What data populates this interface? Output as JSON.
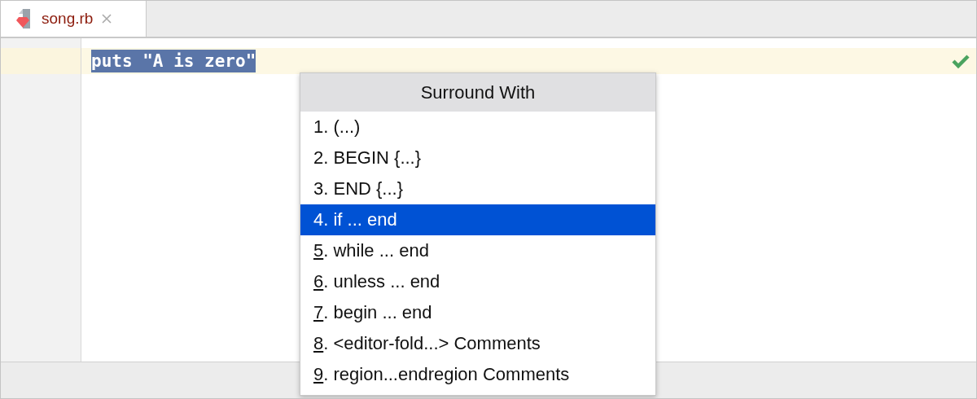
{
  "tabs": [
    {
      "label": "song.rb",
      "selected": true
    }
  ],
  "editor": {
    "code_line": "puts \"A is zero\"",
    "selected_text": true,
    "status_ok": true
  },
  "popup": {
    "title": "Surround With",
    "items": [
      {
        "text": "1. (...)",
        "selected": false,
        "mnemonic_underlined": false
      },
      {
        "text": "2. BEGIN {...}",
        "selected": false,
        "mnemonic_underlined": false
      },
      {
        "text": "3. END {...}",
        "selected": false,
        "mnemonic_underlined": false
      },
      {
        "text": "4. if ... end",
        "selected": true,
        "mnemonic_underlined": false
      },
      {
        "text": "5. while ... end",
        "selected": false,
        "mnemonic_underlined": true
      },
      {
        "text": "6. unless ... end",
        "selected": false,
        "mnemonic_underlined": true
      },
      {
        "text": "7. begin ... end",
        "selected": false,
        "mnemonic_underlined": true
      },
      {
        "text": "8. <editor-fold...> Comments",
        "selected": false,
        "mnemonic_underlined": true
      },
      {
        "text": "9. region...endregion Comments",
        "selected": false,
        "mnemonic_underlined": true
      }
    ]
  }
}
